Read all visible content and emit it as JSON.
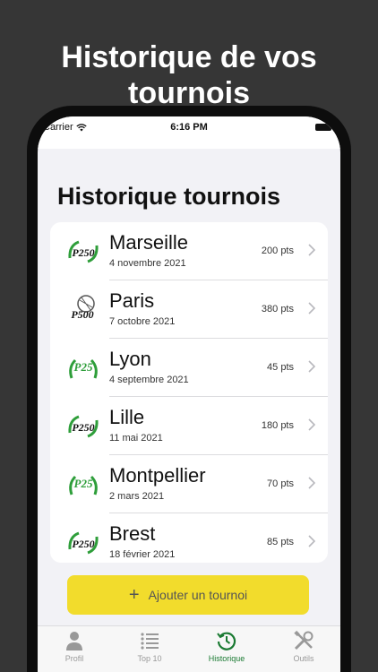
{
  "promo": {
    "title": "Historique de vos tournois"
  },
  "statusbar": {
    "carrier": "Carrier",
    "time": "6:16 PM"
  },
  "page": {
    "title": "Historique tournois"
  },
  "tournaments": [
    {
      "city": "Marseille",
      "date": "4 novembre 2021",
      "points": "200 pts",
      "logo": "p250-logo"
    },
    {
      "city": "Paris",
      "date": "7 octobre 2021",
      "points": "380 pts",
      "logo": "p500-logo"
    },
    {
      "city": "Lyon",
      "date": "4 septembre 2021",
      "points": "45 pts",
      "logo": "p25-logo"
    },
    {
      "city": "Lille",
      "date": "11 mai 2021",
      "points": "180 pts",
      "logo": "p250-logo"
    },
    {
      "city": "Montpellier",
      "date": "2 mars 2021",
      "points": "70 pts",
      "logo": "p25-logo"
    },
    {
      "city": "Brest",
      "date": "18 février 2021",
      "points": "85 pts",
      "logo": "p250-logo"
    }
  ],
  "add_button": {
    "label": "Ajouter un tournoi",
    "color": "#f2dc2c"
  },
  "tabs": [
    {
      "label": "Profil",
      "icon": "person-icon"
    },
    {
      "label": "Top 10",
      "icon": "list-icon"
    },
    {
      "label": "Historique",
      "icon": "history-icon"
    },
    {
      "label": "Outils",
      "icon": "tools-icon"
    }
  ],
  "colors": {
    "accent": "#1a7a32",
    "background": "#363636"
  }
}
